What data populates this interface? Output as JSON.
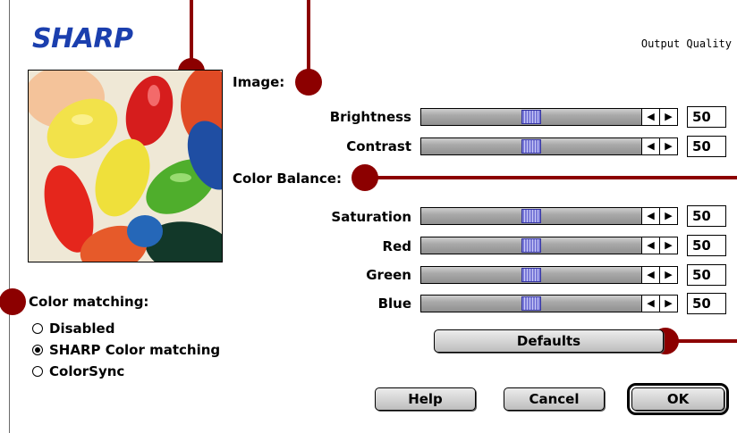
{
  "logo": "SHARP",
  "dialog_title": "Output Quality",
  "image_section": {
    "title": "Image:",
    "sliders": [
      {
        "label": "Brightness",
        "value": "50",
        "fraction": 0.5
      },
      {
        "label": "Contrast",
        "value": "50",
        "fraction": 0.5
      }
    ]
  },
  "color_balance": {
    "title": "Color Balance:",
    "sliders": [
      {
        "label": "Saturation",
        "value": "50",
        "fraction": 0.5
      },
      {
        "label": "Red",
        "value": "50",
        "fraction": 0.5
      },
      {
        "label": "Green",
        "value": "50",
        "fraction": 0.5
      },
      {
        "label": "Blue",
        "value": "50",
        "fraction": 0.5
      }
    ]
  },
  "color_matching": {
    "title": "Color matching:",
    "options": [
      {
        "label": "Disabled",
        "selected": false
      },
      {
        "label": "SHARP Color matching",
        "selected": true
      },
      {
        "label": "ColorSync",
        "selected": false
      }
    ]
  },
  "buttons": {
    "defaults": "Defaults",
    "help": "Help",
    "cancel": "Cancel",
    "ok": "OK"
  },
  "icons": {
    "arrow_left": "◀",
    "arrow_right": "▶"
  },
  "colors": {
    "callout": "#8c0000",
    "brand": "#1b3fae",
    "thumb": "#7a7ad8"
  }
}
